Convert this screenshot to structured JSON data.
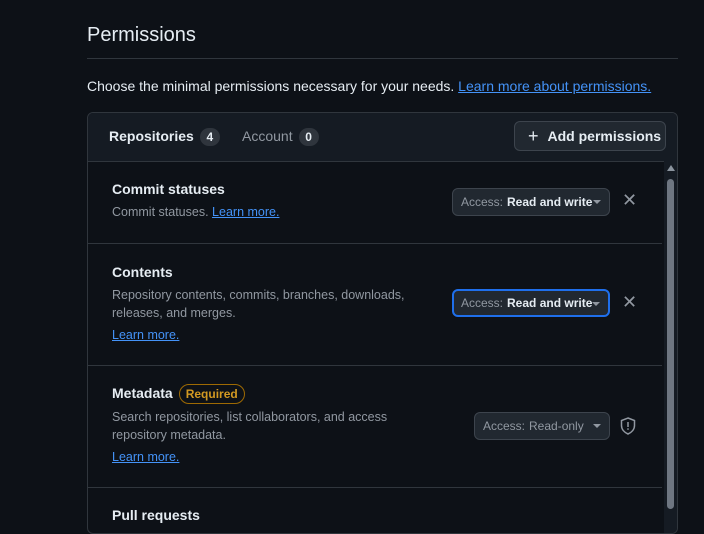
{
  "header": {
    "title": "Permissions",
    "intro_text": "Choose the minimal permissions necessary for your needs. ",
    "intro_link": "Learn more about permissions."
  },
  "tabs": [
    {
      "label": "Repositories",
      "count": "4"
    },
    {
      "label": "Account",
      "count": "0"
    }
  ],
  "add_permissions_label": "Add permissions",
  "permissions": [
    {
      "name": "Commit statuses",
      "badge": "",
      "description": "Commit statuses.",
      "learn_more": "Learn more.",
      "access_label": "Access:",
      "access_value": "Read and write",
      "action_icon": "close-icon"
    },
    {
      "name": "Contents",
      "badge": "",
      "description": "Repository contents, commits, branches, downloads, releases, and merges.",
      "learn_more": "Learn more.",
      "access_label": "Access:",
      "access_value": "Read and write",
      "action_icon": "close-icon"
    },
    {
      "name": "Metadata",
      "badge": "Required",
      "description": "Search repositories, list collaborators, and access repository metadata.",
      "learn_more": "Learn more.",
      "access_label": "Access:",
      "access_value": "Read-only",
      "action_icon": "shield-icon"
    },
    {
      "name": "Pull requests"
    }
  ],
  "colors": {
    "background": "#0d1117",
    "link": "#4493f8",
    "required_badge": "#d29922",
    "focus_ring": "#1f6feb"
  }
}
